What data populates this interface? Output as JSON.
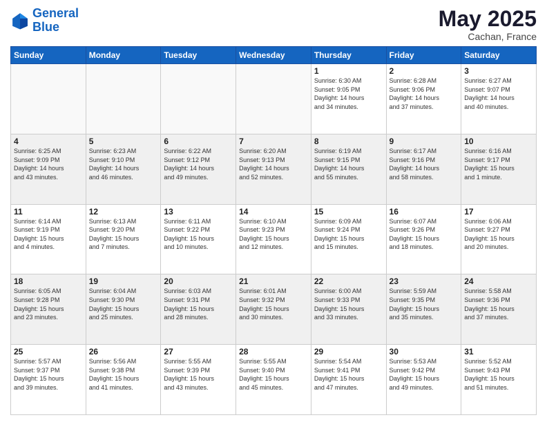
{
  "header": {
    "logo_line1": "General",
    "logo_line2": "Blue",
    "month": "May 2025",
    "location": "Cachan, France"
  },
  "weekdays": [
    "Sunday",
    "Monday",
    "Tuesday",
    "Wednesday",
    "Thursday",
    "Friday",
    "Saturday"
  ],
  "weeks": [
    [
      {
        "day": "",
        "info": ""
      },
      {
        "day": "",
        "info": ""
      },
      {
        "day": "",
        "info": ""
      },
      {
        "day": "",
        "info": ""
      },
      {
        "day": "1",
        "info": "Sunrise: 6:30 AM\nSunset: 9:05 PM\nDaylight: 14 hours\nand 34 minutes."
      },
      {
        "day": "2",
        "info": "Sunrise: 6:28 AM\nSunset: 9:06 PM\nDaylight: 14 hours\nand 37 minutes."
      },
      {
        "day": "3",
        "info": "Sunrise: 6:27 AM\nSunset: 9:07 PM\nDaylight: 14 hours\nand 40 minutes."
      }
    ],
    [
      {
        "day": "4",
        "info": "Sunrise: 6:25 AM\nSunset: 9:09 PM\nDaylight: 14 hours\nand 43 minutes."
      },
      {
        "day": "5",
        "info": "Sunrise: 6:23 AM\nSunset: 9:10 PM\nDaylight: 14 hours\nand 46 minutes."
      },
      {
        "day": "6",
        "info": "Sunrise: 6:22 AM\nSunset: 9:12 PM\nDaylight: 14 hours\nand 49 minutes."
      },
      {
        "day": "7",
        "info": "Sunrise: 6:20 AM\nSunset: 9:13 PM\nDaylight: 14 hours\nand 52 minutes."
      },
      {
        "day": "8",
        "info": "Sunrise: 6:19 AM\nSunset: 9:15 PM\nDaylight: 14 hours\nand 55 minutes."
      },
      {
        "day": "9",
        "info": "Sunrise: 6:17 AM\nSunset: 9:16 PM\nDaylight: 14 hours\nand 58 minutes."
      },
      {
        "day": "10",
        "info": "Sunrise: 6:16 AM\nSunset: 9:17 PM\nDaylight: 15 hours\nand 1 minute."
      }
    ],
    [
      {
        "day": "11",
        "info": "Sunrise: 6:14 AM\nSunset: 9:19 PM\nDaylight: 15 hours\nand 4 minutes."
      },
      {
        "day": "12",
        "info": "Sunrise: 6:13 AM\nSunset: 9:20 PM\nDaylight: 15 hours\nand 7 minutes."
      },
      {
        "day": "13",
        "info": "Sunrise: 6:11 AM\nSunset: 9:22 PM\nDaylight: 15 hours\nand 10 minutes."
      },
      {
        "day": "14",
        "info": "Sunrise: 6:10 AM\nSunset: 9:23 PM\nDaylight: 15 hours\nand 12 minutes."
      },
      {
        "day": "15",
        "info": "Sunrise: 6:09 AM\nSunset: 9:24 PM\nDaylight: 15 hours\nand 15 minutes."
      },
      {
        "day": "16",
        "info": "Sunrise: 6:07 AM\nSunset: 9:26 PM\nDaylight: 15 hours\nand 18 minutes."
      },
      {
        "day": "17",
        "info": "Sunrise: 6:06 AM\nSunset: 9:27 PM\nDaylight: 15 hours\nand 20 minutes."
      }
    ],
    [
      {
        "day": "18",
        "info": "Sunrise: 6:05 AM\nSunset: 9:28 PM\nDaylight: 15 hours\nand 23 minutes."
      },
      {
        "day": "19",
        "info": "Sunrise: 6:04 AM\nSunset: 9:30 PM\nDaylight: 15 hours\nand 25 minutes."
      },
      {
        "day": "20",
        "info": "Sunrise: 6:03 AM\nSunset: 9:31 PM\nDaylight: 15 hours\nand 28 minutes."
      },
      {
        "day": "21",
        "info": "Sunrise: 6:01 AM\nSunset: 9:32 PM\nDaylight: 15 hours\nand 30 minutes."
      },
      {
        "day": "22",
        "info": "Sunrise: 6:00 AM\nSunset: 9:33 PM\nDaylight: 15 hours\nand 33 minutes."
      },
      {
        "day": "23",
        "info": "Sunrise: 5:59 AM\nSunset: 9:35 PM\nDaylight: 15 hours\nand 35 minutes."
      },
      {
        "day": "24",
        "info": "Sunrise: 5:58 AM\nSunset: 9:36 PM\nDaylight: 15 hours\nand 37 minutes."
      }
    ],
    [
      {
        "day": "25",
        "info": "Sunrise: 5:57 AM\nSunset: 9:37 PM\nDaylight: 15 hours\nand 39 minutes."
      },
      {
        "day": "26",
        "info": "Sunrise: 5:56 AM\nSunset: 9:38 PM\nDaylight: 15 hours\nand 41 minutes."
      },
      {
        "day": "27",
        "info": "Sunrise: 5:55 AM\nSunset: 9:39 PM\nDaylight: 15 hours\nand 43 minutes."
      },
      {
        "day": "28",
        "info": "Sunrise: 5:55 AM\nSunset: 9:40 PM\nDaylight: 15 hours\nand 45 minutes."
      },
      {
        "day": "29",
        "info": "Sunrise: 5:54 AM\nSunset: 9:41 PM\nDaylight: 15 hours\nand 47 minutes."
      },
      {
        "day": "30",
        "info": "Sunrise: 5:53 AM\nSunset: 9:42 PM\nDaylight: 15 hours\nand 49 minutes."
      },
      {
        "day": "31",
        "info": "Sunrise: 5:52 AM\nSunset: 9:43 PM\nDaylight: 15 hours\nand 51 minutes."
      }
    ]
  ]
}
